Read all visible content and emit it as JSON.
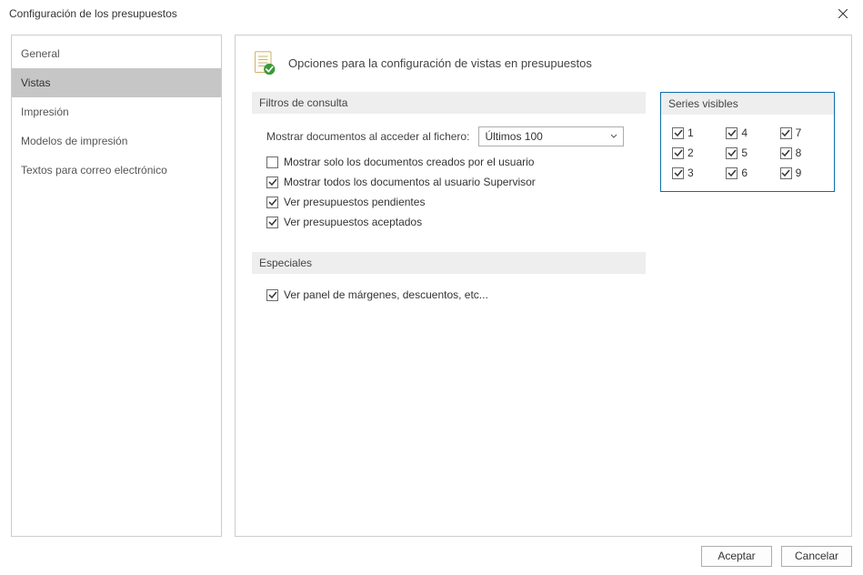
{
  "window": {
    "title": "Configuración de los presupuestos"
  },
  "sidebar": {
    "items": [
      {
        "label": "General",
        "selected": false
      },
      {
        "label": "Vistas",
        "selected": true
      },
      {
        "label": "Impresión",
        "selected": false
      },
      {
        "label": "Modelos de impresión",
        "selected": false
      },
      {
        "label": "Textos para correo electrónico",
        "selected": false
      }
    ]
  },
  "content": {
    "heading": "Opciones para la configuración de vistas en presupuestos",
    "filters": {
      "section_label": "Filtros de consulta",
      "show_docs_label": "Mostrar documentos al acceder al fichero:",
      "show_docs_value": "Últimos 100",
      "checks": [
        {
          "label": "Mostrar solo los documentos creados por el usuario",
          "checked": false
        },
        {
          "label": "Mostrar todos los documentos al usuario Supervisor",
          "checked": true
        },
        {
          "label": "Ver presupuestos pendientes",
          "checked": true
        },
        {
          "label": "Ver presupuestos aceptados",
          "checked": true
        }
      ]
    },
    "especiales": {
      "section_label": "Especiales",
      "checks": [
        {
          "label": "Ver panel de márgenes, descuentos, etc...",
          "checked": true
        }
      ]
    },
    "series": {
      "section_label": "Series visibles",
      "items": [
        {
          "label": "1",
          "checked": true
        },
        {
          "label": "2",
          "checked": true
        },
        {
          "label": "3",
          "checked": true
        },
        {
          "label": "4",
          "checked": true
        },
        {
          "label": "5",
          "checked": true
        },
        {
          "label": "6",
          "checked": true
        },
        {
          "label": "7",
          "checked": true
        },
        {
          "label": "8",
          "checked": true
        },
        {
          "label": "9",
          "checked": true
        }
      ]
    }
  },
  "footer": {
    "accept": "Aceptar",
    "cancel": "Cancelar"
  }
}
